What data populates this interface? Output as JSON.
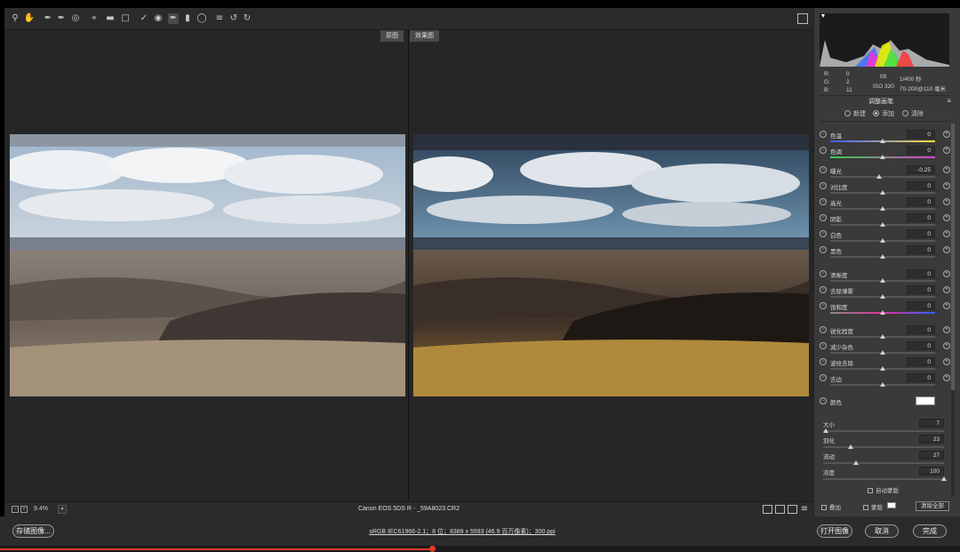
{
  "preview": {
    "label_before": "原图",
    "label_after": "效果图",
    "zoom": "9.4%",
    "filename": "Canon EOS 5DS R - _59A8023.CR2"
  },
  "footer": {
    "save_label": "存储图像...",
    "workflow_info": "sRGB IEC61966-2.1；8 位；8389 x 5593 (46.9 百万像素)；300 ppi",
    "open_label": "打开图像",
    "cancel_label": "取消",
    "done_label": "完成",
    "progress_fraction": 0.45
  },
  "panel": {
    "rgb": {
      "r_label": "R:",
      "g_label": "G:",
      "b_label": "B:",
      "r": "0",
      "g": "2",
      "b": "11"
    },
    "exif": {
      "aperture": "f/8",
      "shutter": "1/400 秒",
      "iso": "ISO 320",
      "lens": "70-200@110 毫米"
    },
    "title": "调整画笔",
    "menu_icon": "menu-icon",
    "modes": [
      {
        "label": "新建"
      },
      {
        "label": "添加"
      },
      {
        "label": "清除"
      }
    ],
    "sliders": [
      {
        "label": "色温",
        "value": "0",
        "pos": 0.5
      },
      {
        "label": "色调",
        "value": "0",
        "pos": 0.5
      },
      {
        "label": "曝光",
        "value": "-0.25",
        "pos": 0.47
      },
      {
        "label": "对比度",
        "value": "0",
        "pos": 0.5
      },
      {
        "label": "高光",
        "value": "0",
        "pos": 0.5
      },
      {
        "label": "阴影",
        "value": "0",
        "pos": 0.5
      },
      {
        "label": "白色",
        "value": "0",
        "pos": 0.5
      },
      {
        "label": "黑色",
        "value": "0",
        "pos": 0.5
      },
      {
        "label": "清晰度",
        "value": "0",
        "pos": 0.5
      },
      {
        "label": "去除薄雾",
        "value": "0",
        "pos": 0.5
      },
      {
        "label": "饱和度",
        "value": "0",
        "pos": 0.5
      },
      {
        "label": "锐化程度",
        "value": "0",
        "pos": 0.5
      },
      {
        "label": "减少杂色",
        "value": "0",
        "pos": 0.5
      },
      {
        "label": "波纹去除",
        "value": "0",
        "pos": 0.5
      },
      {
        "label": "去边",
        "value": "0",
        "pos": 0.5
      }
    ],
    "color_label": "颜色",
    "brush": [
      {
        "label": "大小",
        "value": "7",
        "pos": 0.02
      },
      {
        "label": "羽化",
        "value": "23",
        "pos": 0.23
      },
      {
        "label": "流动",
        "value": "27",
        "pos": 0.27
      },
      {
        "label": "浓度",
        "value": "100",
        "pos": 1.0
      }
    ],
    "auto_mask": "自动蒙版",
    "overlay": "叠加",
    "mask": "蒙版",
    "clear_all": "清除全部"
  },
  "colors": {
    "accent": "#e23b2a",
    "panel_bg": "#3a3a3a",
    "preview_bg": "#262626"
  }
}
